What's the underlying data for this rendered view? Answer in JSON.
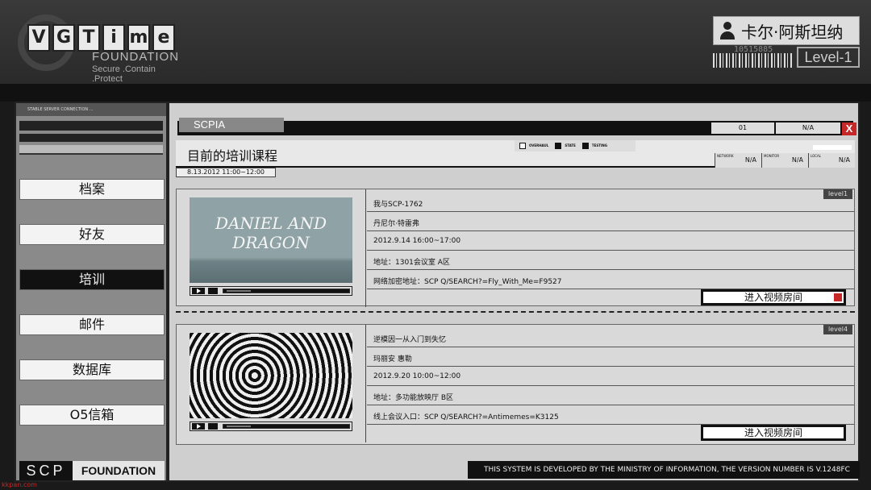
{
  "header": {
    "watermark": [
      "V",
      "G",
      "T",
      "i",
      "m",
      "e"
    ],
    "logo_title": "FOUNDATION",
    "logo_sub": "Secure .Contain .Protect",
    "user_name": "卡尔·阿斯坦纳",
    "user_id": "10515885",
    "level": "Level-1"
  },
  "sidebar": {
    "top_text": "STABLE SERVER CONNECTION ...",
    "items": [
      {
        "label": "档案",
        "active": false
      },
      {
        "label": "好友",
        "active": false
      },
      {
        "label": "培训",
        "active": true
      },
      {
        "label": "邮件",
        "active": false
      },
      {
        "label": "数据库",
        "active": false
      },
      {
        "label": "O5信箱",
        "active": false
      }
    ],
    "footer_scp": "SCP",
    "footer_foundation": "FOUNDATION"
  },
  "main": {
    "tab_label": "SCPIA",
    "tab_01": "01",
    "tab_na": "N/A",
    "close_label": "X",
    "page_title": "目前的培训课程",
    "date_range": "8.13.2012 11:00~12:00",
    "status_items": [
      "OVERHAUL",
      "STATE",
      "TESTING"
    ],
    "meters": [
      {
        "label": "NETWORK",
        "value": "N/A"
      },
      {
        "label": "MONITOR",
        "value": "N/A"
      },
      {
        "label": "LOCAL",
        "value": "N/A"
      }
    ]
  },
  "courses": [
    {
      "level": "level1",
      "thumb_text": "DANIEL AND DRAGON",
      "title": "我与SCP-1762",
      "instructor": "丹尼尔·特雷弗",
      "time": "2012.9.14 16:00~17:00",
      "location": "地址：1301会议室 A区",
      "link": "网络加密地址：SCP Q/SEARCH?=Fly_With_Me=F9527",
      "enter_label": "进入视频房间"
    },
    {
      "level": "level4",
      "thumb_text": "",
      "title": "逆模因一从入门到失忆",
      "instructor": "玛丽安 惠勒",
      "time": "2012.9.20 10:00~12:00",
      "location": "地址：多功能放映厅 B区",
      "link": "线上会议入口：SCP Q/SEARCH?=Antimemes=K3125",
      "enter_label": "进入视频房间"
    }
  ],
  "footer": {
    "notice": "THIS SYSTEM IS DEVELOPED BY THE MINISTRY OF INFORMATION, THE VERSION NUMBER IS V.1248FC",
    "watermark_site": "kkpan.com"
  },
  "colors": {
    "accent_red": "#c62828"
  }
}
